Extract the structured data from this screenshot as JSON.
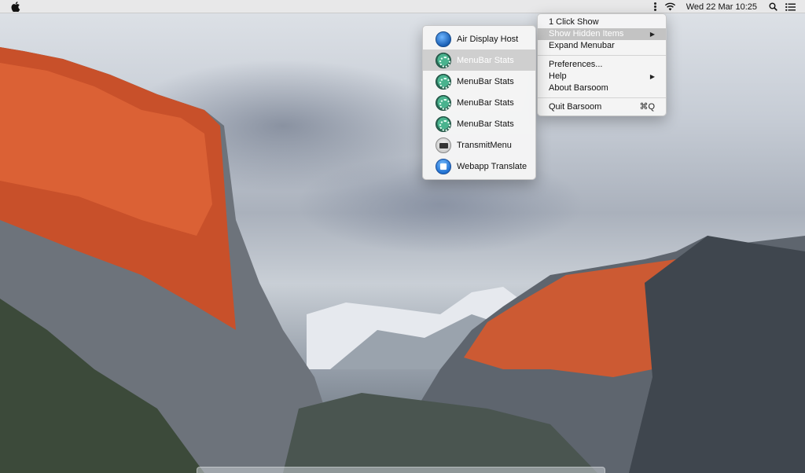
{
  "menubar": {
    "clock": "Wed 22 Mar 10:25",
    "icons": [
      "apple-icon",
      "kebab-icon",
      "wifi-icon",
      "search-icon",
      "list-icon"
    ]
  },
  "barsoom_menu": {
    "items": [
      {
        "label": "1 Click Show"
      },
      {
        "label": "Show Hidden Items",
        "submenu_arrow": "▶"
      },
      {
        "label": "Expand Menubar"
      },
      {
        "label": "Preferences..."
      },
      {
        "label": "Help",
        "submenu_arrow": "▶"
      },
      {
        "label": "About Barsoom"
      },
      {
        "label": "Quit Barsoom",
        "shortcut": "⌘Q"
      }
    ]
  },
  "hidden_items_menu": {
    "items": [
      {
        "label": "Air Display Host",
        "icon": "air-display-icon"
      },
      {
        "label": "MenuBar Stats",
        "icon": "menubar-stats-icon"
      },
      {
        "label": "MenuBar Stats",
        "icon": "menubar-stats-icon"
      },
      {
        "label": "MenuBar Stats",
        "icon": "menubar-stats-icon"
      },
      {
        "label": "MenuBar Stats",
        "icon": "menubar-stats-icon"
      },
      {
        "label": "TransmitMenu",
        "icon": "transmit-icon"
      },
      {
        "label": "Webapp Translate",
        "icon": "webapp-translate-icon"
      }
    ]
  },
  "colors": {
    "menu_highlight": "#c3c3c3",
    "menubar_bg": "#e8e8e8"
  }
}
